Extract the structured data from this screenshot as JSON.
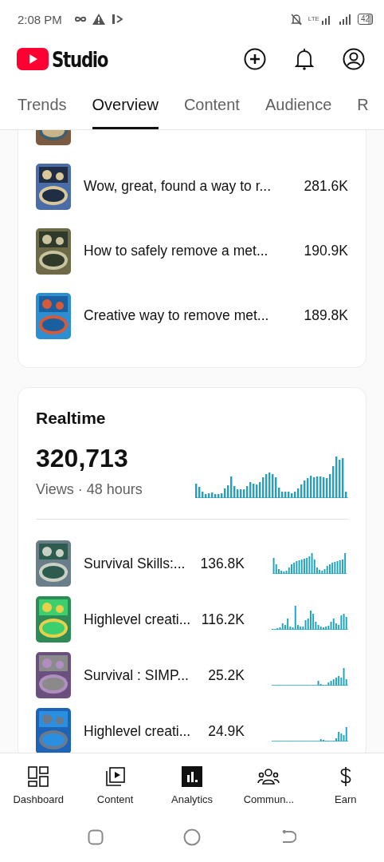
{
  "status_bar": {
    "time": "2:08 PM",
    "network": "LTE",
    "battery": "42"
  },
  "header": {
    "logo_text": "Studio"
  },
  "tabs": [
    {
      "label": "Trends",
      "selected": false
    },
    {
      "label": "Overview",
      "selected": true
    },
    {
      "label": "Content",
      "selected": false
    },
    {
      "label": "Audience",
      "selected": false
    },
    {
      "label": "R",
      "selected": false
    }
  ],
  "top_videos": [
    {
      "title": "Wow, great, found a way to r...",
      "views": "281.6K"
    },
    {
      "title": "How to safely remove a met...",
      "views": "190.9K"
    },
    {
      "title": "Creative way to remove met...",
      "views": "189.8K"
    }
  ],
  "realtime": {
    "title": "Realtime",
    "views": "320,713",
    "subtitle": "Views · 48 hours",
    "videos": [
      {
        "title": "Survival Skills:...",
        "views": "136.8K"
      },
      {
        "title": "Highlevel creati...",
        "views": "116.2K"
      },
      {
        "title": "Survival : SIMP...",
        "views": "25.2K"
      },
      {
        "title": "Highlevel creati...",
        "views": "24.9K"
      }
    ]
  },
  "bottom_nav": [
    {
      "label": "Dashboard",
      "kind": "dashboard",
      "selected": false
    },
    {
      "label": "Content",
      "kind": "content",
      "selected": false
    },
    {
      "label": "Analytics",
      "kind": "analytics",
      "selected": true
    },
    {
      "label": "Commun...",
      "kind": "community",
      "selected": false
    },
    {
      "label": "Earn",
      "kind": "earn",
      "selected": false
    }
  ]
}
